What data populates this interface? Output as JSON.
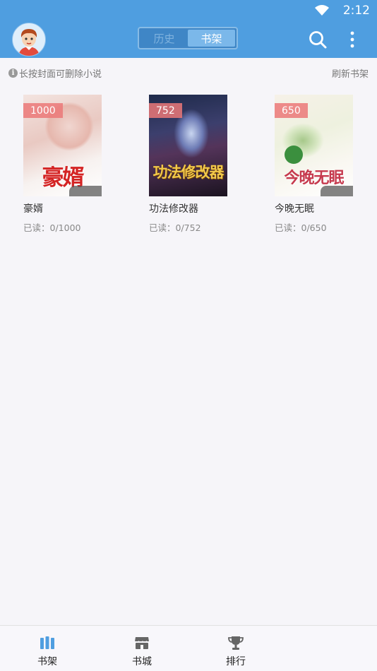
{
  "status": {
    "time": "2:12"
  },
  "header": {
    "tabs": [
      {
        "label": "历史",
        "active": false
      },
      {
        "label": "书架",
        "active": true
      }
    ],
    "accent": "#4f9ee0"
  },
  "hint": {
    "text": "长按封面可删除小说",
    "refresh": "刷新书架"
  },
  "books": [
    {
      "title": "豪婿",
      "badge": "1000",
      "progress": "已读：0/1000",
      "cover_title": "豪婿"
    },
    {
      "title": "功法修改器",
      "badge": "752",
      "progress": "已读：0/752",
      "cover_title": "功法修改器"
    },
    {
      "title": "今晚无眠",
      "badge": "650",
      "progress": "已读：0/650",
      "cover_title": "今晚无眠"
    }
  ],
  "bottom_nav": [
    {
      "label": "书架",
      "icon": "bookshelf-icon",
      "active": true
    },
    {
      "label": "书城",
      "icon": "store-icon",
      "active": false
    },
    {
      "label": "排行",
      "icon": "trophy-icon",
      "active": false
    }
  ]
}
